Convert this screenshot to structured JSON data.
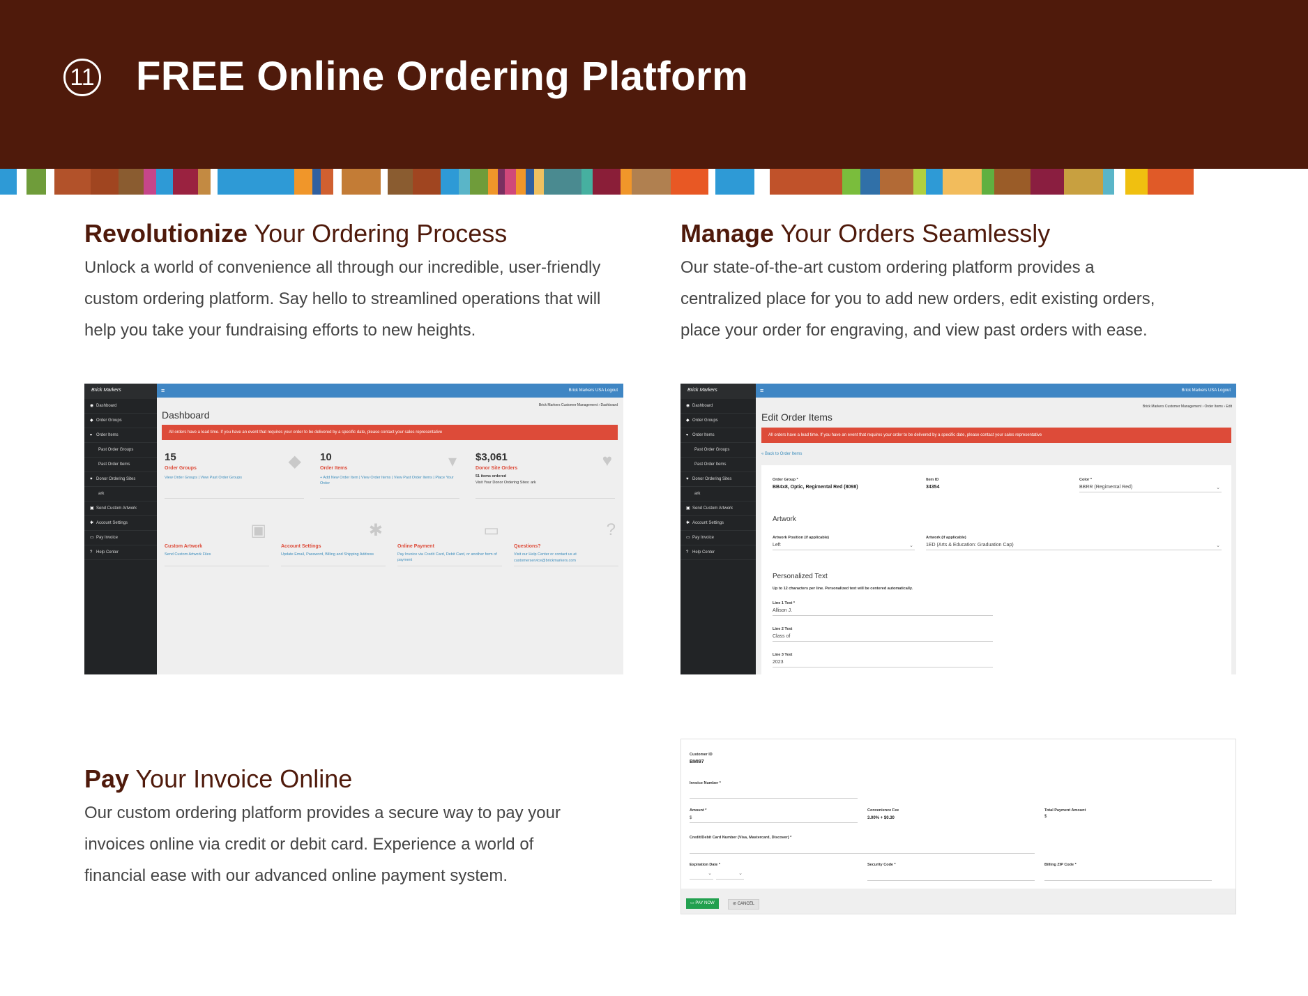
{
  "header": {
    "number": "11",
    "title": "FREE Online Ordering Platform"
  },
  "stripe_colors": [
    "#2e9ad6",
    "#ffffff",
    "#6f9c3a",
    "#ffffff",
    "#b2522a",
    "#a04520",
    "#8a5c30",
    "#c6468a",
    "#2e9ad6",
    "#9a2240",
    "#c38a42",
    "#ffffff",
    "#2e9ad6",
    "#f0962a",
    "#3060a0",
    "#d06030",
    "#ffffff",
    "#c37c36",
    "#ffffff",
    "#8a5c30",
    "#a04520",
    "#2e9ad6",
    "#5ab5c8",
    "#6f9c3a",
    "#f0962a",
    "#7a3060",
    "#d0487a",
    "#f0962a",
    "#3060a0",
    "#f0c060",
    "#4a8a90",
    "#46b0a0",
    "#8a1e38",
    "#f0962a",
    "#b08050",
    "#e85824",
    "#ffffff",
    "#2e9ad6",
    "#ffffff",
    "#c0522a",
    "#7abd3c",
    "#3070a8",
    "#b26a36",
    "#b0d040",
    "#2e9ad6",
    "#f2bc5c",
    "#60b040",
    "#9a5c28",
    "#8a1e40",
    "#c8a040",
    "#5ab5c8",
    "#ffffff",
    "#f0c010",
    "#e05a28"
  ],
  "revolutionize": {
    "title_bold": "Revolutionize",
    "title_rest": " Your Ordering Process",
    "lines": [
      "Unlock a world of convenience all through our incredible, user-friendly",
      "custom ordering platform. Say hello to streamlined operations that will",
      "help you take your fundraising efforts to new heights."
    ]
  },
  "manage": {
    "title_bold": "Manage",
    "title_rest": " Your Orders Seamlessly",
    "lines": [
      "Our state-of-the-art custom ordering platform provides a",
      "centralized place for you to add new orders, edit existing orders,",
      "place your order for engraving, and view past orders with ease."
    ]
  },
  "pay": {
    "title_bold": "Pay",
    "title_rest": " Your Invoice Online",
    "lines": [
      "Our custom ordering platform provides a secure way to pay your",
      "invoices online via credit or debit card. Experience a world of",
      "financial ease with our advanced online payment system."
    ]
  },
  "app": {
    "logo": "Brick Markers",
    "top_right": "Brick Markers USA    Logout",
    "sidebar": [
      "Dashboard",
      "Order Groups",
      "Order Items",
      "Past Order Groups",
      "Past Order Items",
      "Donor Ordering Sites",
      "ark",
      "Send Custom Artwork",
      "Account Settings",
      "Pay Invoice",
      "Help Center"
    ],
    "alert": "All orders have a lead time. If you have an event that requires your order to be delivered by a specific date, please contact your sales representative"
  },
  "dashboard": {
    "title": "Dashboard",
    "breadcrumb": "Brick Markers Customer Management  ›  Dashboard",
    "cards": [
      {
        "big": "15",
        "title": "Order Groups",
        "links": "View Order Groups | View Past Order Groups"
      },
      {
        "big": "10",
        "title": "Order Items",
        "links": "+ Add New Order Item | View Order Items | View Past Order Items | Place Your Order"
      },
      {
        "big": "$3,061",
        "title": "Donor Site Orders",
        "text1": "51 items ordered",
        "text2": "Visit Your Donor Ordering Sites: ark"
      }
    ],
    "tiles": [
      {
        "title": "Custom Artwork",
        "links": "Send Custom Artwork Files"
      },
      {
        "title": "Account Settings",
        "links": "Update Email, Password, Billing and Shipping Address"
      },
      {
        "title": "Online Payment",
        "links": "Pay Invoice via Credit Card, Debit Card, or another form of payment"
      },
      {
        "title": "Questions?",
        "links": "Visit our Help Center or contact us at customerservice@brickmarkers.com"
      }
    ]
  },
  "edit": {
    "title": "Edit Order Items",
    "breadcrumb": "Brick Markers Customer Management  ›  Order Items  ›  Edit",
    "back": "« Back to Order Items",
    "order_group_label": "Order Group *",
    "order_group_value": "BB4x8, Optic, Regimental Red (8098)",
    "item_id_label": "Item ID",
    "item_id_value": "34354",
    "color_label": "Color *",
    "color_value": "BBRR (Regimental Red)",
    "artwork_heading": "Artwork",
    "art_pos_label": "Artwork Position (if applicable)",
    "art_pos_value": "Left",
    "art_label": "Artwork (if applicable)",
    "art_value": "1ED (Arts & Education: Graduation Cap)",
    "ptext_heading": "Personalized Text",
    "ptext_note": "Up to 12 characters per line. Personalized text will be centered automatically.",
    "line1_label": "Line 1 Text *",
    "line1_value": "Allison J.",
    "line2_label": "Line 2 Text",
    "line2_value": "Class of",
    "line3_label": "Line 3 Text",
    "line3_value": "2023"
  },
  "invoice": {
    "customer_id_label": "Customer ID",
    "customer_id_value": "BMI97",
    "invoice_number_label": "Invoice Number *",
    "amount_label": "Amount *",
    "amount_prefix": "$",
    "fee_label": "Convenience Fee",
    "fee_value": "3.00% + $0.30",
    "total_label": "Total Payment Amount",
    "total_prefix": "$",
    "card_label": "Credit/Debit Card Number (Visa, Mastercard, Discover) *",
    "exp_label": "Expiration Date *",
    "sec_label": "Security Code *",
    "zip_label": "Billing ZIP Code *",
    "pay_button": "PAY NOW",
    "cancel_button": "CANCEL"
  }
}
